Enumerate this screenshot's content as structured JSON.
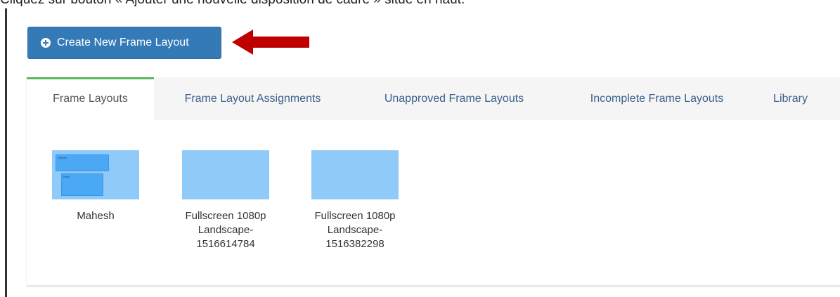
{
  "instruction": "Cliquez sur bouton « Ajouter une nouvelle disposition de cadre » situé en haut.",
  "toolbar": {
    "create_label": "Create New Frame Layout",
    "create_icon": "plus-circle-icon",
    "arrow_icon": "arrow-left-icon",
    "arrow_color": "#c00000"
  },
  "tabs": [
    {
      "label": "Frame Layouts",
      "active": true
    },
    {
      "label": "Frame Layout Assignments",
      "active": false
    },
    {
      "label": "Unapproved Frame Layouts",
      "active": false
    },
    {
      "label": "Incomplete Frame Layouts",
      "active": false
    },
    {
      "label": "Library",
      "active": false
    }
  ],
  "layouts": [
    {
      "name": "Mahesh",
      "zones": [
        "Header",
        "Body"
      ]
    },
    {
      "name": "Fullscreen 1080p\nLandscape-\n1516614784"
    },
    {
      "name": "Fullscreen 1080p\nLandscape-\n1516382298"
    }
  ],
  "colors": {
    "primary_button": "#337ab7",
    "active_tab_accent": "#5cb85c",
    "thumbnail_bg": "#90caf9",
    "zone_fill": "#4aa8f5"
  }
}
